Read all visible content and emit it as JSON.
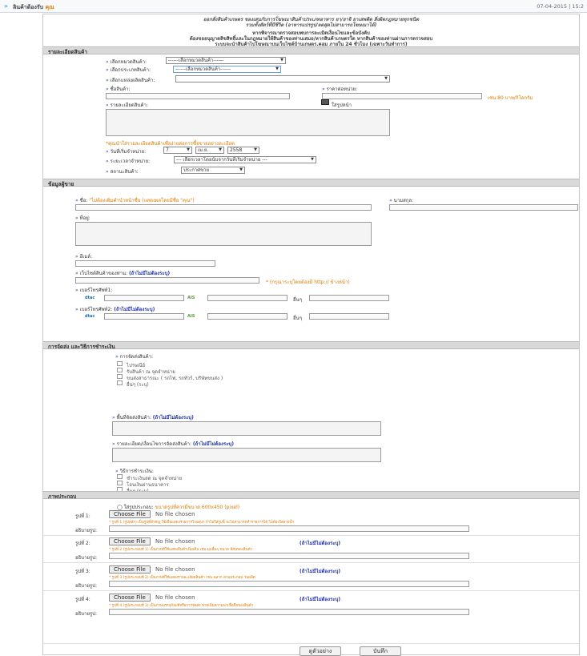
{
  "header": {
    "title": "ลินค้าต้องรับ",
    "title_highlight": "คุณ",
    "datetime": "07-04-2015 | 15:2"
  },
  "notice": {
    "line1": "ออกสั่งสินค้าเกษตร ของเสนกับการโฆษณาสินค้าประเภทอาหาร ยา/ยาจิ ยาเสพติด สิ่งผิดกฎหมายทุกชนิด",
    "line2": "รวมทั้งสัตว์ที่มีชีวิต (อาหารแปรรูป/ลดสุดไม่สามารถโฆษณาได้)",
    "line3": "หากพิจารณาตรวจสอบพบการละเมิดเงื่อนไขและข้อบังคับ",
    "line4": "ต้องขออนุญาตลิขสิทธิ์และในกฎหมายให้สินค้าของท่านเสมอ/หากสินค้าเกษตรใด หากสินค้าของท่านผ่านการตรวจสอบ",
    "line5": "ระบบจะนำสินค้าไปโฆษณาบนเว็บไซต์บ้านเกษตร.คอม ภายใน 24 ชั่วโมง (เฉพาะวันทำการ)"
  },
  "product": {
    "section_title": "รายละเอียดสินค้า",
    "category_label": "เลือกหมวดสินค้า:",
    "category_value": "------เลือกหมวดสินค้า------",
    "type_label": "เลือกประเภทสินค้า:",
    "type_value": "------เลือกหมวดสินค้า------",
    "source_label": "เลือกแหล่งผลิตสินค้า:",
    "source_value": "",
    "name_label": "ชื่อสินค้า:",
    "price_label": "ราคาต่อหน่วย:",
    "price_hint": "เช่น 80 บาท/กิโลกรัม",
    "detail_label": "รายละเอียดสินค้า:",
    "upload_label": "ใส่รูปหน้า",
    "detail_hint": "*คุณนำใส่รายละเอียดสินค้าเพื่อง่ายต่อการซื้อขายอย่างละเอียด",
    "start_label": "วันที่เริ่มจำหน่าย:",
    "start_day": "7",
    "start_month": "เม.ย.",
    "start_year": "2558",
    "period_label": "ระยะเวลาจำหน่าย:",
    "period_value": "--- เลือกเวลาโดยนับจากวันที่เริ่มจำหน่าย ---",
    "status_label": "สถานะสินค้า:",
    "status_value": "ประกาศขาย"
  },
  "seller": {
    "section_title": "ข้อมูลผู้ขาย",
    "name_label": "ชื่อ:",
    "name_hint": "\"ไม่ต้องเติมคำนำหน้าชื่อ (แสดงผลโดยมีชื่อ \"คุณ\")",
    "surname_label": "นามสกุล:",
    "address_label": "ที่อยู่:",
    "email_label": "อีเมล์:",
    "website_label": "เว็บไซต์สินค้าของท่าน:",
    "optional": "(ถ้าไม่มีไม่ต้องระบุ)",
    "website_hint": "* (กรุณาระบุโดยต้องมี http:// ข้างหน้า)",
    "phone1_label": "เบอร์โทรศัพท์1:",
    "phone2_label": "เบอร์โทรศัพท์2:",
    "dtac": "dtac",
    "ais": "AIS",
    "other": "อื่นๆ"
  },
  "shipping": {
    "section_title": "การจัดส่ง และวิธีการชำระเงิน",
    "method_label": "การจัดส่งสินค้า:",
    "methods": [
      "ไปรษณีย์",
      "รับสินค้า ณ จุดจำหน่าย",
      "ขนส่งสาธารณะ ( รถไฟ, รถทัวร์, บริษัทขนส่ง )",
      "อื่นๆ (ระบุ)"
    ],
    "area_label": "พื้นที่จัดส่งสินค้า:",
    "condition_label": "รายละเอียด/เงื่อนไขการจัดส่งสินค้า:",
    "payment_label": "วิธีการชำระเงิน:",
    "payments": [
      "ชำระเงินสด ณ จุดจำหน่าย",
      "โอนเงินผ่านธนาคาร",
      "อื่นๆ (ระบุ)"
    ]
  },
  "photos": {
    "section_title": "ภาพประกอบ",
    "radio_label": "ใส่รูปประกอบ:",
    "size_hint": "ขนาดรูปที่ควรมีขนาด 600x450 (pixel)",
    "choose": "Choose File",
    "no_file": "No file chosen",
    "desc_label": "อธิบายรูป:",
    "items": [
      {
        "label": "รูปที่ 1:",
        "note": "* รูปที่ 1 (รูปหลัก) เป็นรูปที่สำคัญ ใช้เพื่อแสดงรายการโฆษณา ถ้าไม่ใส่รูปนี้ จะไม่สามารถทำรายการได้ ไม่ต้องใส่ลายน้ำ"
      },
      {
        "label": "รูปที่ 2:",
        "note": "* รูปที่ 2 (รูปประกอบที่ 1) เป็นภาพที่ใช้แสดงสินค้าเพิ่มเติม เช่น มุมอื่นๆ ขนาด สีสันของสินค้า"
      },
      {
        "label": "รูปที่ 3:",
        "note": "* รูปที่ 3 (รูปประกอบที่ 2) เป็นภาพที่ใช้แสดงรายละเอียดสินค้า เช่น ฉลาก ส่วนประกอบ วันผลิต"
      },
      {
        "label": "รูปที่ 4:",
        "note": "* รูปที่ 4 (รูปประกอบที่ 3) เป็นภาพบรรจุภัณฑ์หรือการจัดส่ง ช่วยเพิ่มความน่าเชื่อถือของสินค้า"
      }
    ]
  },
  "actions": {
    "preview": "ดูตัวอย่าง",
    "save": "บันทึก"
  }
}
